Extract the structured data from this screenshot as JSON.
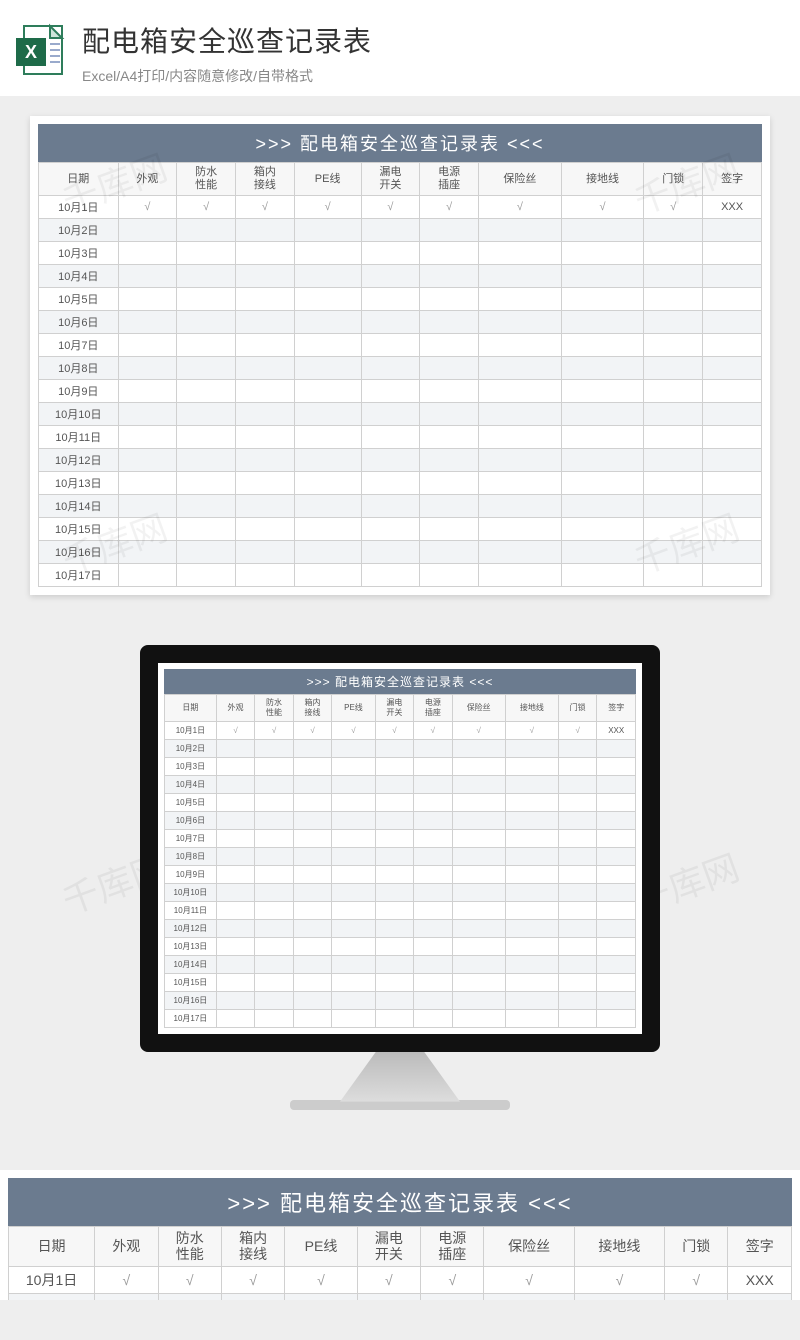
{
  "header": {
    "title": "配电箱安全巡查记录表",
    "subtitle": "Excel/A4打印/内容随意修改/自带格式"
  },
  "banner": {
    "text": ">>>  配电箱安全巡查记录表  <<<"
  },
  "columns": [
    "日期",
    "外观",
    "防水性能",
    "箱内接线",
    "PE线",
    "漏电开关",
    "电源插座",
    "保险丝",
    "接地线",
    "门锁",
    "签字"
  ],
  "rows": [
    {
      "date": "10月1日",
      "c": [
        "√",
        "√",
        "√",
        "√",
        "√",
        "√",
        "√",
        "√",
        "√"
      ],
      "sign": "XXX"
    },
    {
      "date": "10月2日",
      "c": [
        "",
        "",
        "",
        "",
        "",
        "",
        "",
        "",
        ""
      ],
      "sign": ""
    },
    {
      "date": "10月3日",
      "c": [
        "",
        "",
        "",
        "",
        "",
        "",
        "",
        "",
        ""
      ],
      "sign": ""
    },
    {
      "date": "10月4日",
      "c": [
        "",
        "",
        "",
        "",
        "",
        "",
        "",
        "",
        ""
      ],
      "sign": ""
    },
    {
      "date": "10月5日",
      "c": [
        "",
        "",
        "",
        "",
        "",
        "",
        "",
        "",
        ""
      ],
      "sign": ""
    },
    {
      "date": "10月6日",
      "c": [
        "",
        "",
        "",
        "",
        "",
        "",
        "",
        "",
        ""
      ],
      "sign": ""
    },
    {
      "date": "10月7日",
      "c": [
        "",
        "",
        "",
        "",
        "",
        "",
        "",
        "",
        ""
      ],
      "sign": ""
    },
    {
      "date": "10月8日",
      "c": [
        "",
        "",
        "",
        "",
        "",
        "",
        "",
        "",
        ""
      ],
      "sign": ""
    },
    {
      "date": "10月9日",
      "c": [
        "",
        "",
        "",
        "",
        "",
        "",
        "",
        "",
        ""
      ],
      "sign": ""
    },
    {
      "date": "10月10日",
      "c": [
        "",
        "",
        "",
        "",
        "",
        "",
        "",
        "",
        ""
      ],
      "sign": ""
    },
    {
      "date": "10月11日",
      "c": [
        "",
        "",
        "",
        "",
        "",
        "",
        "",
        "",
        ""
      ],
      "sign": ""
    },
    {
      "date": "10月12日",
      "c": [
        "",
        "",
        "",
        "",
        "",
        "",
        "",
        "",
        ""
      ],
      "sign": ""
    },
    {
      "date": "10月13日",
      "c": [
        "",
        "",
        "",
        "",
        "",
        "",
        "",
        "",
        ""
      ],
      "sign": ""
    },
    {
      "date": "10月14日",
      "c": [
        "",
        "",
        "",
        "",
        "",
        "",
        "",
        "",
        ""
      ],
      "sign": ""
    },
    {
      "date": "10月15日",
      "c": [
        "",
        "",
        "",
        "",
        "",
        "",
        "",
        "",
        ""
      ],
      "sign": ""
    },
    {
      "date": "10月16日",
      "c": [
        "",
        "",
        "",
        "",
        "",
        "",
        "",
        "",
        ""
      ],
      "sign": ""
    },
    {
      "date": "10月17日",
      "c": [
        "",
        "",
        "",
        "",
        "",
        "",
        "",
        "",
        ""
      ],
      "sign": ""
    }
  ],
  "watermark": "千库网"
}
